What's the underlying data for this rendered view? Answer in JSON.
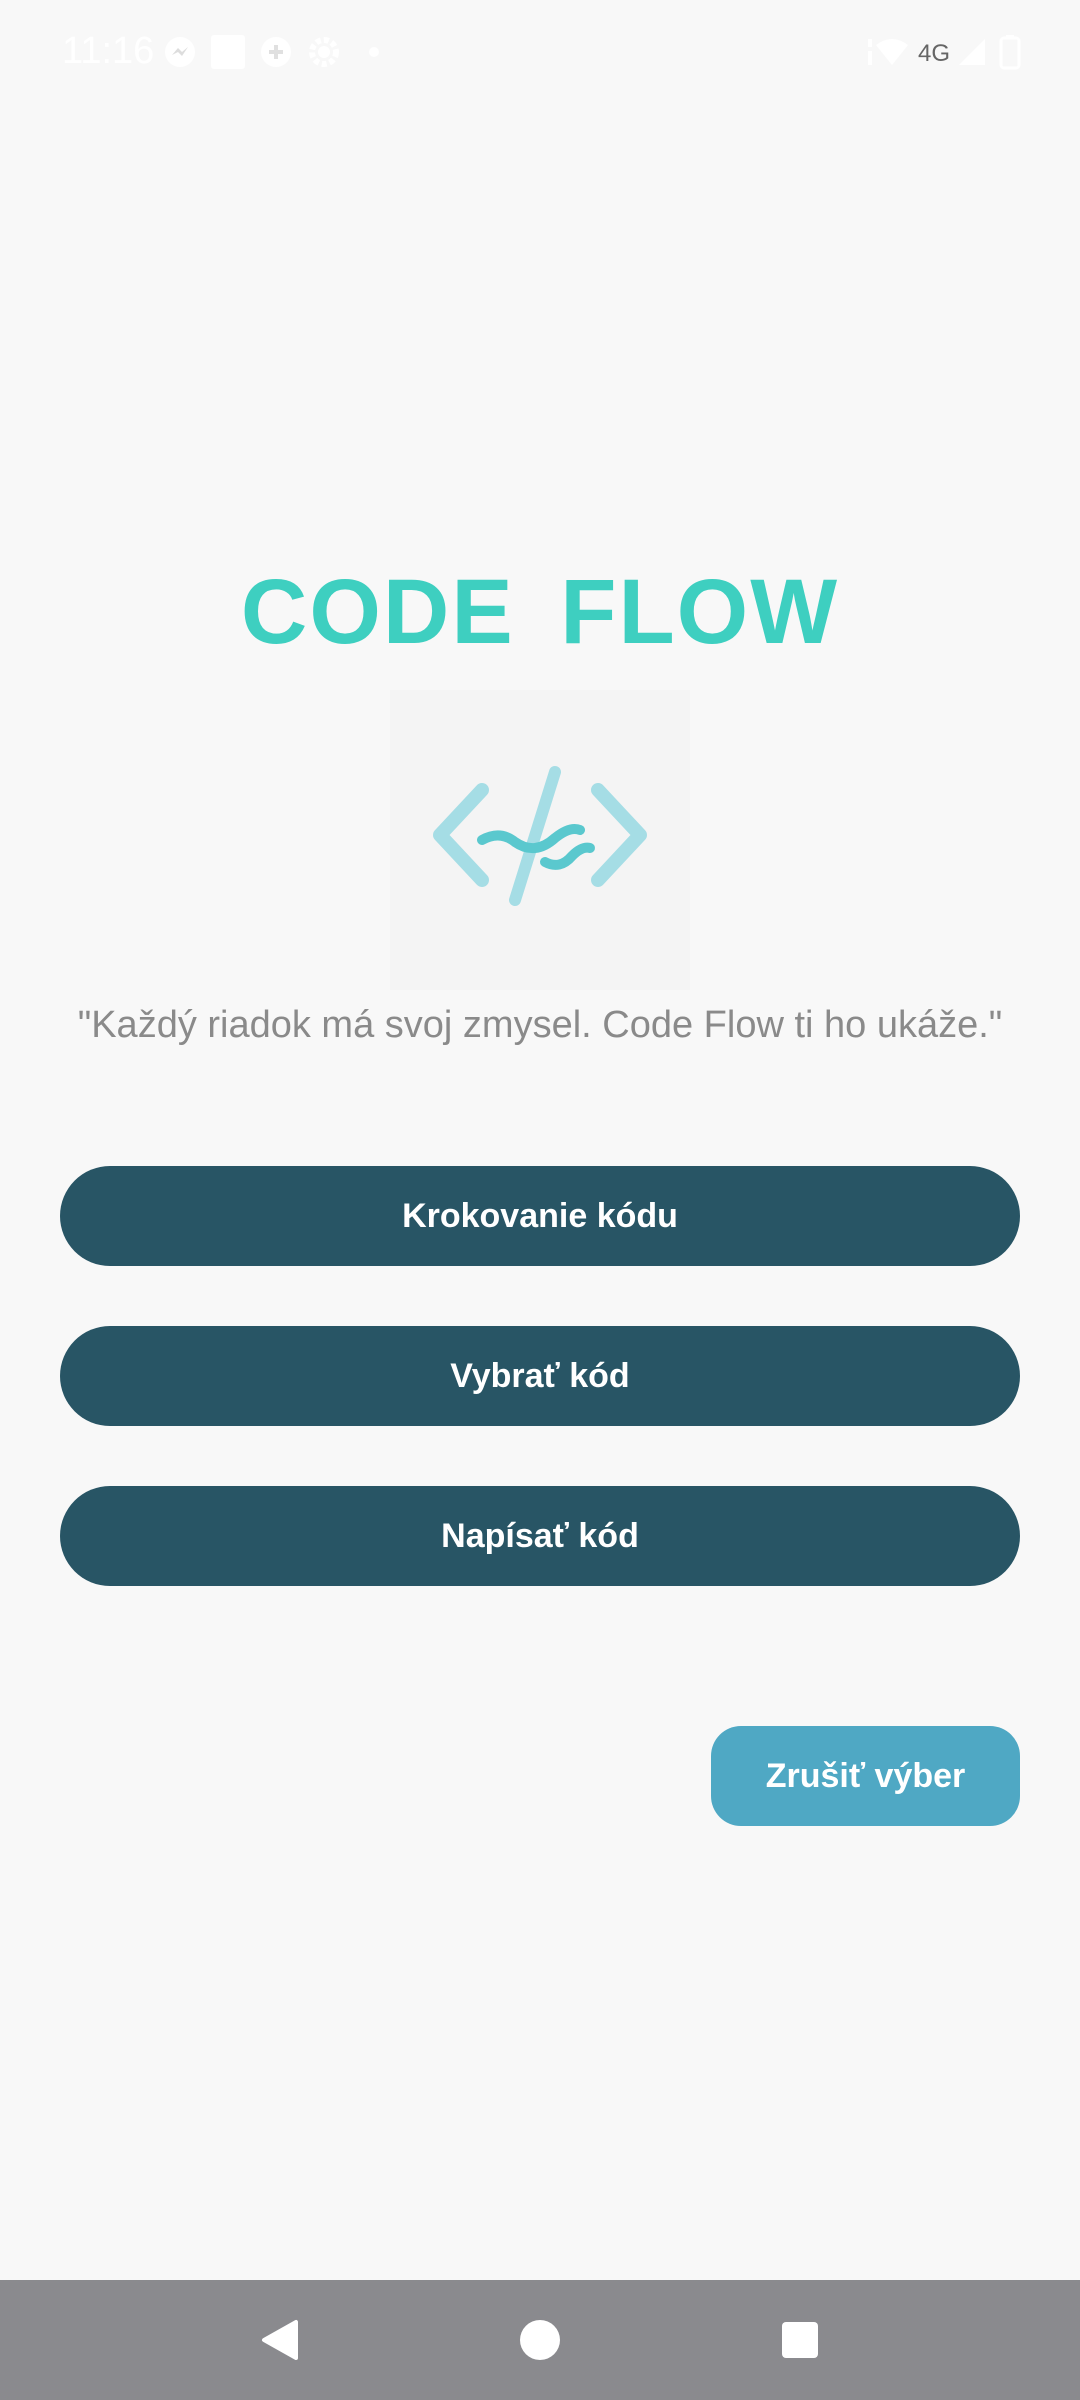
{
  "status_bar": {
    "time": "11:16",
    "network": "4G",
    "icons": [
      "messenger-icon",
      "square-notification-icon",
      "game-controller-icon",
      "settings-icon",
      "dot-icon",
      "signal-icon",
      "wifi-icon",
      "cell-signal-icon",
      "battery-icon"
    ]
  },
  "app": {
    "title": "CODE  FLOW",
    "logo_icon": "code-flow-logo-icon",
    "tagline": "\"Každý riadok má svoj zmysel. Code Flow ti ho ukáže.\"",
    "accent_color": "#3ecfc0"
  },
  "menu": {
    "buttons": [
      {
        "label": "Krokovanie kódu"
      },
      {
        "label": "Vybrať kód"
      },
      {
        "label": "Napísať kód"
      }
    ],
    "button_color": "#285565"
  },
  "cancel": {
    "label": "Zrušiť výber",
    "color": "#4fa8c4"
  },
  "nav_bar": {
    "items": [
      "back-icon",
      "home-icon",
      "recents-icon"
    ]
  }
}
